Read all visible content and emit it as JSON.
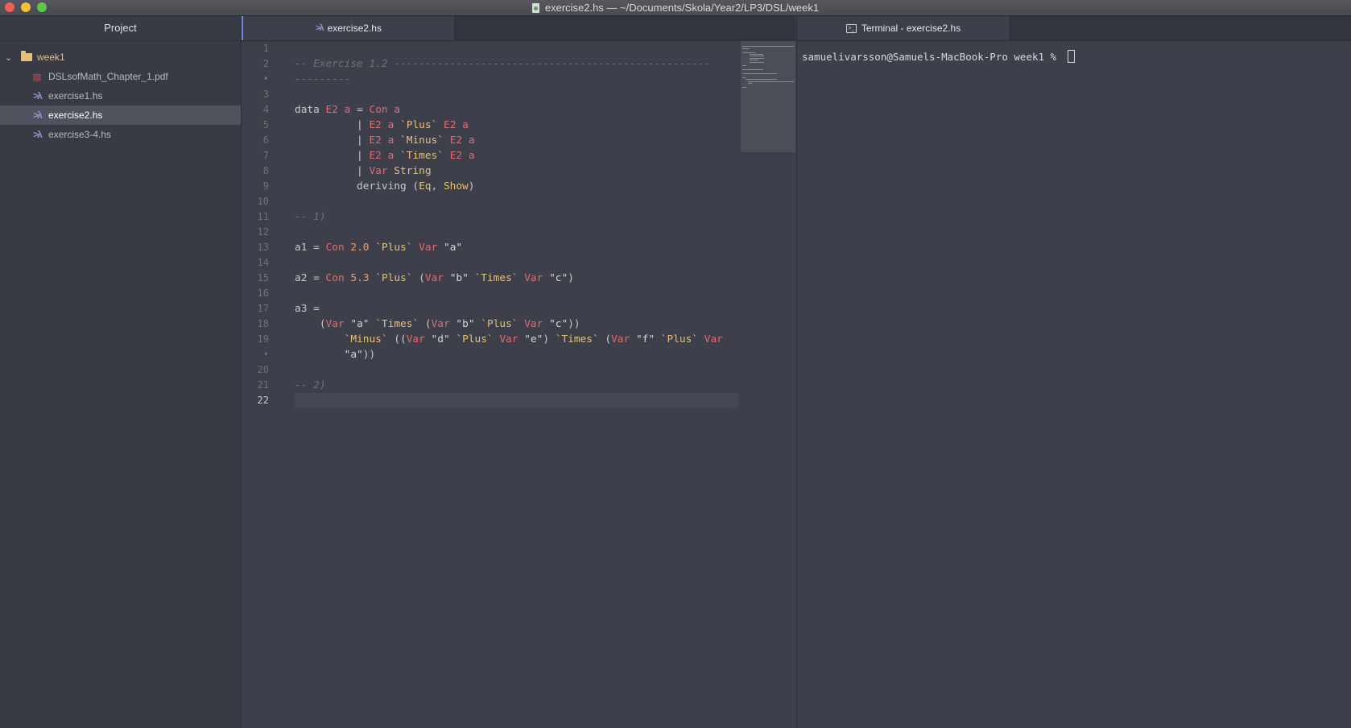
{
  "window": {
    "title": "exercise2.hs — ~/Documents/Skola/Year2/LP3/DSL/week1"
  },
  "sidebar": {
    "header": "Project",
    "root_folder": "week1",
    "files": [
      {
        "name": "DSLsofMath_Chapter_1.pdf",
        "icon": "pdf-icon",
        "selected": false
      },
      {
        "name": "exercise1.hs",
        "icon": "haskell-icon",
        "selected": false
      },
      {
        "name": "exercise2.hs",
        "icon": "haskell-icon",
        "selected": true
      },
      {
        "name": "exercise3-4.hs",
        "icon": "haskell-icon",
        "selected": false
      }
    ]
  },
  "editor": {
    "tab_label": "exercise2.hs",
    "line_numbers": [
      "1",
      "2",
      "•",
      "3",
      "4",
      "5",
      "6",
      "7",
      "8",
      "9",
      "10",
      "11",
      "12",
      "13",
      "14",
      "15",
      "16",
      "17",
      "18",
      "19",
      "•",
      "20",
      "21",
      "22"
    ],
    "code_lines": [
      "",
      "-- Exercise 1.2 ---------------------------------------------------",
      "---------",
      "",
      "data E2 a = Con a",
      "          | E2 a `Plus` E2 a",
      "          | E2 a `Minus` E2 a",
      "          | E2 a `Times` E2 a",
      "          | Var String",
      "          deriving (Eq, Show)",
      "",
      "-- 1)",
      "",
      "a1 = Con 2.0 `Plus` Var \"a\"",
      "",
      "a2 = Con 5.3 `Plus` (Var \"b\" `Times` Var \"c\")",
      "",
      "a3 =",
      "    (Var \"a\" `Times` (Var \"b\" `Plus` Var \"c\"))",
      "        `Minus` ((Var \"d\" `Plus` Var \"e\") `Times` (Var \"f\" `Plus` Var",
      "        \"a\"))",
      "",
      "-- 2)",
      ""
    ]
  },
  "terminal": {
    "tab_label": "Terminal - exercise2.hs",
    "prompt": "samuelivarsson@Samuels-MacBook-Pro week1 % "
  }
}
